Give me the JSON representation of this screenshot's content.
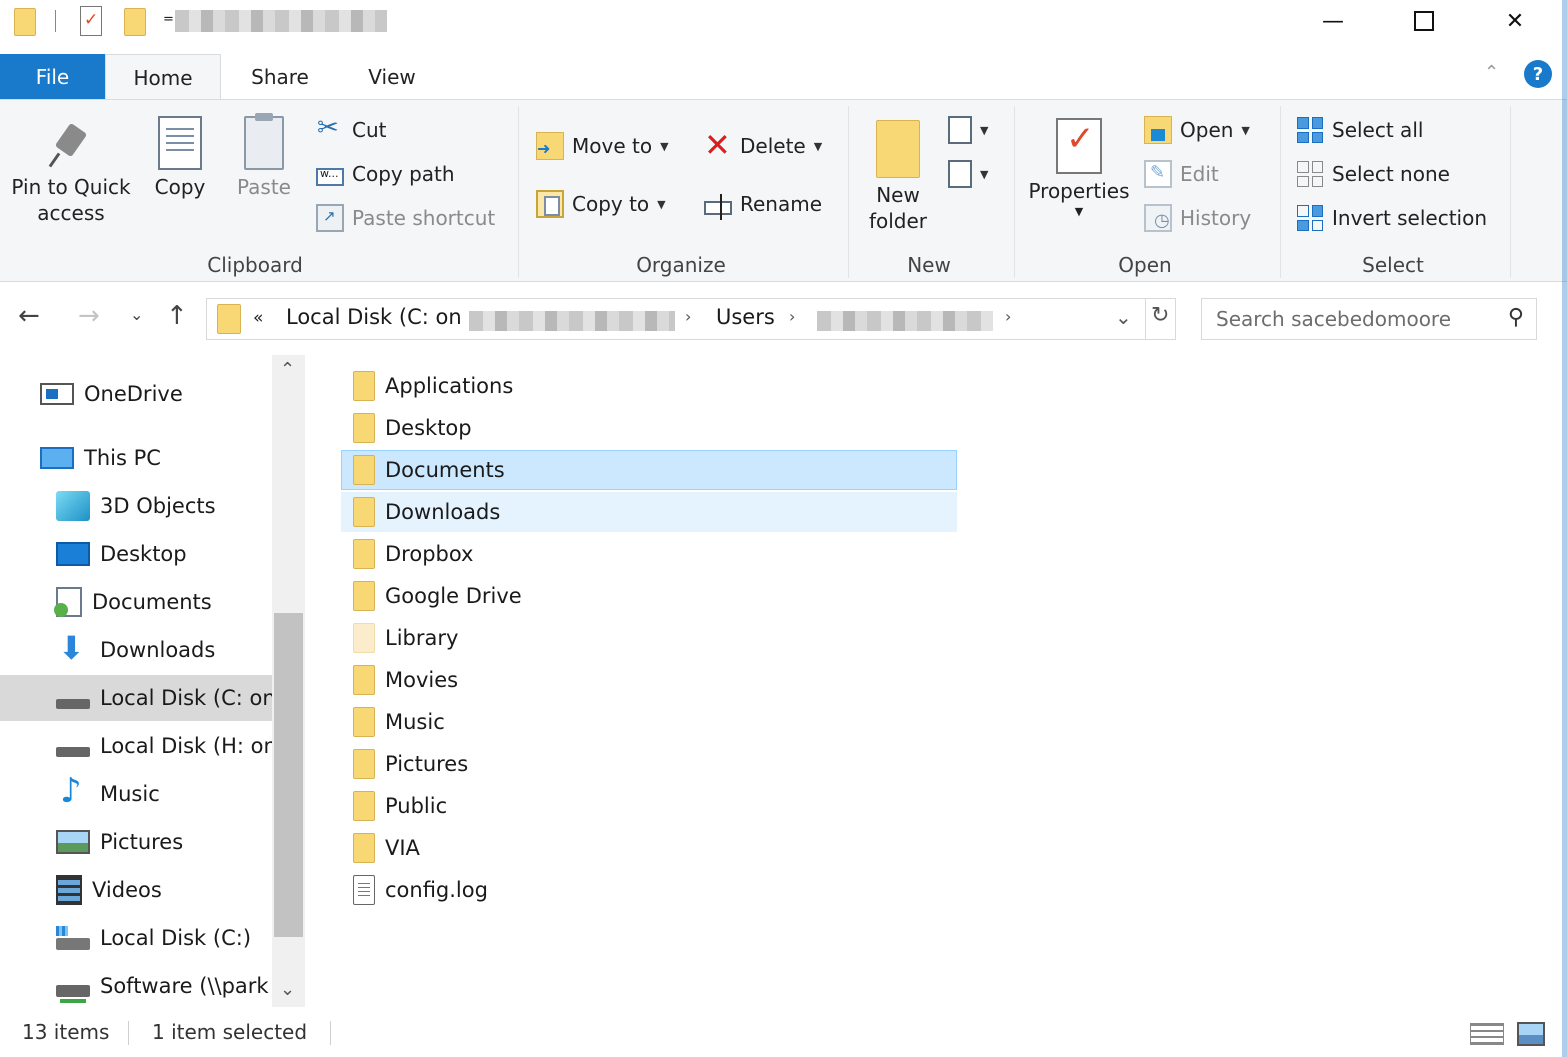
{
  "titlebar": {
    "qa_dropdown": "="
  },
  "tabs": {
    "file": "File",
    "home": "Home",
    "share": "Share",
    "view": "View",
    "help": "?"
  },
  "ribbon": {
    "clipboard": {
      "label": "Clipboard",
      "pin": "Pin to Quick access",
      "copy": "Copy",
      "paste": "Paste",
      "cut": "Cut",
      "copy_path": "Copy path",
      "paste_shortcut": "Paste shortcut"
    },
    "organize": {
      "label": "Organize",
      "move_to": "Move to",
      "copy_to": "Copy to",
      "delete": "Delete",
      "rename": "Rename"
    },
    "new": {
      "label": "New",
      "new_folder": "New folder"
    },
    "open": {
      "label": "Open",
      "properties": "Properties",
      "open": "Open",
      "edit": "Edit",
      "history": "History"
    },
    "select": {
      "label": "Select",
      "select_all": "Select all",
      "select_none": "Select none",
      "invert_selection": "Invert selection"
    }
  },
  "address": {
    "overflow": "«",
    "crumb_drive": "Local Disk (C: on",
    "crumb_users": "Users",
    "search_placeholder": "Search sacebedomoore"
  },
  "sidebar": {
    "items": [
      {
        "label": "OneDrive",
        "icon": "onedrive-icon"
      },
      {
        "label": "This PC",
        "icon": "this-pc-icon"
      },
      {
        "label": "3D Objects",
        "icon": "3d-objects-icon"
      },
      {
        "label": "Desktop",
        "icon": "desktop-icon"
      },
      {
        "label": "Documents",
        "icon": "documents-icon"
      },
      {
        "label": "Downloads",
        "icon": "downloads-icon"
      },
      {
        "label": "Local Disk (C: on",
        "icon": "drive-icon",
        "selected": true
      },
      {
        "label": "Local Disk (H: on",
        "icon": "drive-icon"
      },
      {
        "label": "Music",
        "icon": "music-icon"
      },
      {
        "label": "Pictures",
        "icon": "pictures-icon"
      },
      {
        "label": "Videos",
        "icon": "videos-icon"
      },
      {
        "label": "Local Disk (C:)",
        "icon": "local-disk-icon"
      },
      {
        "label": "Software (\\\\park",
        "icon": "network-drive-icon"
      }
    ]
  },
  "files": [
    {
      "name": "Applications",
      "type": "folder"
    },
    {
      "name": "Desktop",
      "type": "folder"
    },
    {
      "name": "Documents",
      "type": "folder",
      "state": "selected"
    },
    {
      "name": "Downloads",
      "type": "folder",
      "state": "hover"
    },
    {
      "name": "Dropbox",
      "type": "folder"
    },
    {
      "name": "Google Drive",
      "type": "folder"
    },
    {
      "name": "Library",
      "type": "folder",
      "hidden": true
    },
    {
      "name": "Movies",
      "type": "folder"
    },
    {
      "name": "Music",
      "type": "folder"
    },
    {
      "name": "Pictures",
      "type": "folder"
    },
    {
      "name": "Public",
      "type": "folder"
    },
    {
      "name": "VIA",
      "type": "folder"
    },
    {
      "name": "config.log",
      "type": "file"
    }
  ],
  "status": {
    "count": "13 items",
    "selection": "1 item selected"
  },
  "colors": {
    "accent": "#1979ca",
    "selection": "#cce8ff",
    "hover": "#e5f3ff",
    "folder": "#f8d775"
  }
}
